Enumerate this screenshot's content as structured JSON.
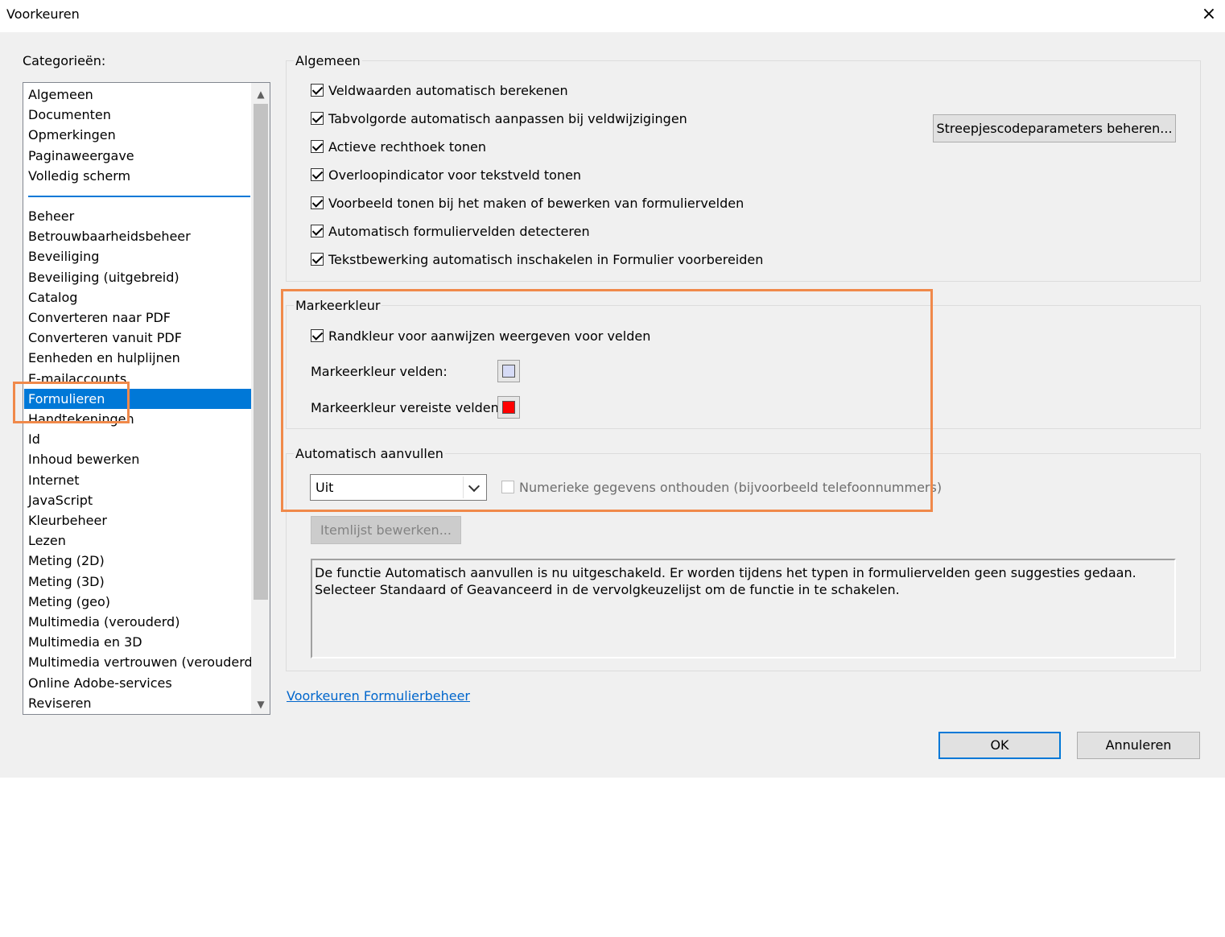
{
  "window": {
    "title": "Voorkeuren",
    "close_icon": "×"
  },
  "categories": {
    "label": "Categorieën:",
    "top_items": [
      "Algemeen",
      "Documenten",
      "Opmerkingen",
      "Paginaweergave",
      "Volledig scherm"
    ],
    "items": [
      "Beheer",
      "Betrouwbaarheidsbeheer",
      "Beveiliging",
      "Beveiliging (uitgebreid)",
      "Catalog",
      "Converteren naar PDF",
      "Converteren vanuit PDF",
      "Eenheden en hulplijnen",
      "E-mailaccounts",
      "Formulieren",
      "Handtekeningen",
      "Id",
      "Inhoud bewerken",
      "Internet",
      "JavaScript",
      "Kleurbeheer",
      "Lezen",
      "Meting (2D)",
      "Meting (3D)",
      "Meting (geo)",
      "Multimedia (verouderd)",
      "Multimedia en 3D",
      "Multimedia vertrouwen (verouderd)",
      "Online Adobe-services",
      "Reviseren"
    ],
    "selected": "Formulieren",
    "scroll_up_icon": "▲",
    "scroll_down_icon": "▼"
  },
  "algemeen": {
    "label": "Algemeen",
    "checkboxes": [
      {
        "label": "Veldwaarden automatisch berekenen",
        "checked": true
      },
      {
        "label": "Tabvolgorde automatisch aanpassen bij veldwijzigingen",
        "checked": true
      },
      {
        "label": "Actieve rechthoek tonen",
        "checked": true
      },
      {
        "label": "Overloopindicator voor tekstveld tonen",
        "checked": true
      },
      {
        "label": "Voorbeeld tonen bij het maken of bewerken van formuliervelden",
        "checked": true
      },
      {
        "label": "Automatisch formuliervelden detecteren",
        "checked": true
      },
      {
        "label": "Tekstbewerking automatisch inschakelen in Formulier voorbereiden",
        "checked": true
      }
    ],
    "barcode_button": "Streepjescodeparameters beheren..."
  },
  "markeerkleur": {
    "label": "Markeerkleur",
    "border_checkbox": {
      "label": "Randkleur voor aanwijzen weergeven voor velden",
      "checked": true
    },
    "fields_label": "Markeerkleur velden:",
    "fields_color": "#d6dbf6",
    "required_label": "Markeerkleur vereiste velden:",
    "required_color": "#ff0000"
  },
  "autocomplete": {
    "label": "Automatisch aanvullen",
    "select_value": "Uit",
    "numeric_checkbox": {
      "label": "Numerieke gegevens onthouden (bijvoorbeeld telefoonnummers)",
      "checked": false,
      "disabled": true
    },
    "edit_list_button": "Itemlijst bewerken...",
    "description": "De functie Automatisch aanvullen is nu uitgeschakeld. Er worden tijdens het typen in formuliervelden geen suggesties gedaan. Selecteer Standaard of Geavanceerd in de vervolgkeuzelijst om de functie in te schakelen."
  },
  "link": "Voorkeuren Formulierbeheer",
  "buttons": {
    "ok": "OK",
    "cancel": "Annuleren"
  },
  "colors": {
    "accent": "#0078d7",
    "highlight_outline": "#f0894a",
    "link": "#0066cc"
  }
}
